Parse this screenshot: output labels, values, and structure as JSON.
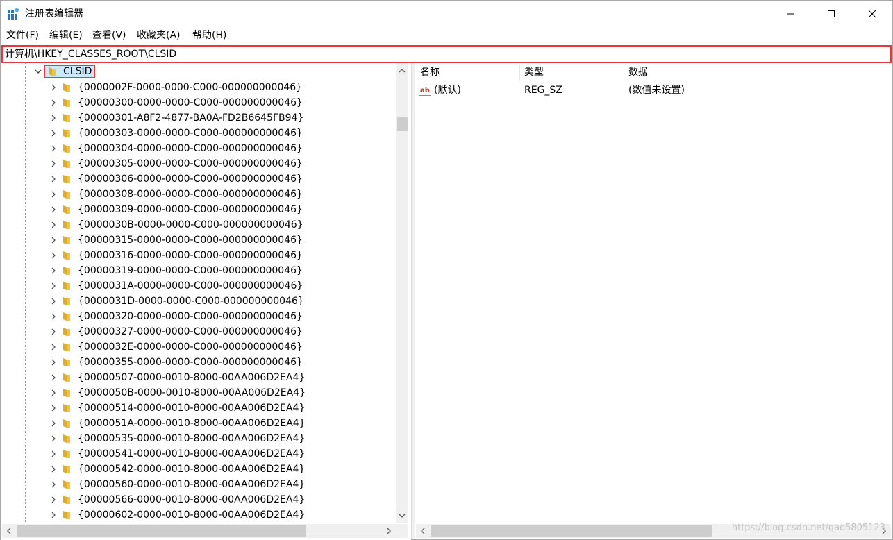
{
  "window": {
    "title": "注册表编辑器"
  },
  "menu": [
    "文件(F)",
    "编辑(E)",
    "查看(V)",
    "收藏夹(A)",
    "帮助(H)"
  ],
  "address": {
    "path": "计算机\\HKEY_CLASSES_ROOT\\CLSID"
  },
  "tree": {
    "selected": "CLSID",
    "keys": [
      "{0000002F-0000-0000-C000-000000000046}",
      "{00000300-0000-0000-C000-000000000046}",
      "{00000301-A8F2-4877-BA0A-FD2B6645FB94}",
      "{00000303-0000-0000-C000-000000000046}",
      "{00000304-0000-0000-C000-000000000046}",
      "{00000305-0000-0000-C000-000000000046}",
      "{00000306-0000-0000-C000-000000000046}",
      "{00000308-0000-0000-C000-000000000046}",
      "{00000309-0000-0000-C000-000000000046}",
      "{0000030B-0000-0000-C000-000000000046}",
      "{00000315-0000-0000-C000-000000000046}",
      "{00000316-0000-0000-C000-000000000046}",
      "{00000319-0000-0000-C000-000000000046}",
      "{0000031A-0000-0000-C000-000000000046}",
      "{0000031D-0000-0000-C000-000000000046}",
      "{00000320-0000-0000-C000-000000000046}",
      "{00000327-0000-0000-C000-000000000046}",
      "{0000032E-0000-0000-C000-000000000046}",
      "{00000355-0000-0000-C000-000000000046}",
      "{00000507-0000-0010-8000-00AA006D2EA4}",
      "{0000050B-0000-0010-8000-00AA006D2EA4}",
      "{00000514-0000-0010-8000-00AA006D2EA4}",
      "{0000051A-0000-0010-8000-00AA006D2EA4}",
      "{00000535-0000-0010-8000-00AA006D2EA4}",
      "{00000541-0000-0010-8000-00AA006D2EA4}",
      "{00000542-0000-0010-8000-00AA006D2EA4}",
      "{00000560-0000-0010-8000-00AA006D2EA4}",
      "{00000566-0000-0010-8000-00AA006D2EA4}",
      "{00000602-0000-0010-8000-00AA006D2EA4}"
    ]
  },
  "list": {
    "columns": {
      "name": "名称",
      "type": "类型",
      "data": "数据"
    },
    "values": [
      {
        "name": "(默认)",
        "type": "REG_SZ",
        "data": "(数值未设置)"
      }
    ]
  },
  "watermark": "https://blog.csdn.net/gao5805123",
  "colors": {
    "highlight_border": "#e23b3b",
    "selection": "#cce8ff",
    "folder": "#f0c540"
  }
}
